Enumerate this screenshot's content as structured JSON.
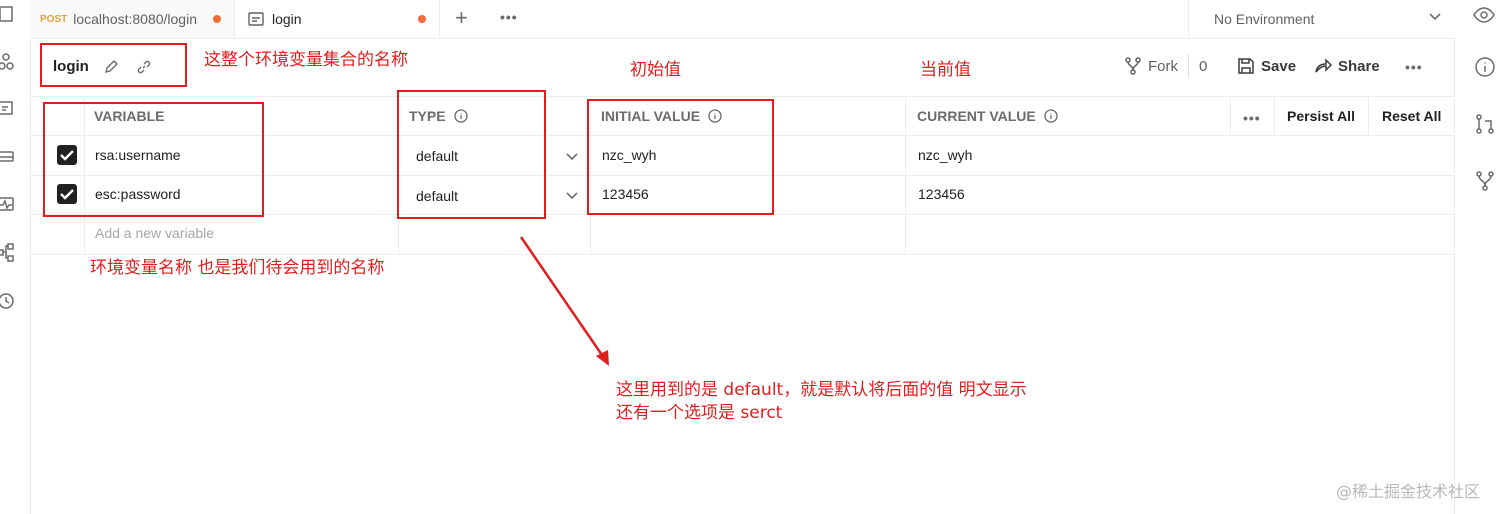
{
  "tabs": [
    {
      "method": "POST",
      "label": "localhost:8080/login"
    },
    {
      "label": "login"
    }
  ],
  "environment_selector": {
    "value": "No Environment"
  },
  "header": {
    "title": "login",
    "fork_label": "Fork",
    "fork_count": "0",
    "save_label": "Save",
    "share_label": "Share"
  },
  "table": {
    "columns": [
      "VARIABLE",
      "TYPE",
      "INITIAL VALUE",
      "CURRENT VALUE"
    ],
    "persist_all": "Persist All",
    "reset_all": "Reset All",
    "rows": [
      {
        "checked": true,
        "variable": "rsa:username",
        "type": "default",
        "initial": "nzc_wyh",
        "current": "nzc_wyh"
      },
      {
        "checked": true,
        "variable": "esc:password",
        "type": "default",
        "initial": "123456",
        "current": "123456"
      }
    ],
    "add_placeholder": "Add a new variable"
  },
  "annotations": {
    "set_name": "这整个环境变量集合的名称",
    "initial_value": "初始值",
    "current_value": "当前值",
    "variable_name": "环境变量名称 也是我们待会用到的名称",
    "type_note_line1": "这里用到的是 default，就是默认将后面的值 明文显示",
    "type_note_line2": "还有一个选项是 serct",
    "color": "#e01e1e"
  },
  "watermark": "@稀土掘金技术社区"
}
